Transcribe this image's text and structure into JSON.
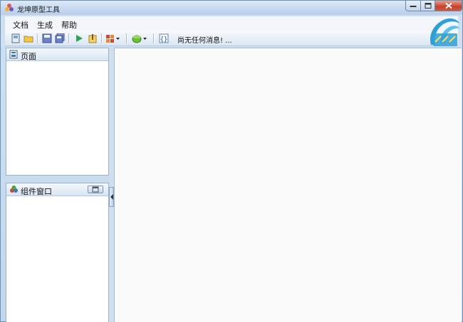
{
  "window": {
    "title": "龙坤原型工具"
  },
  "menu": {
    "items": [
      {
        "label": "文档"
      },
      {
        "label": "生成"
      },
      {
        "label": "帮助"
      }
    ]
  },
  "toolbar": {
    "status_message": "尚无任何消息!  ..."
  },
  "panels": {
    "pages": {
      "title": "页面"
    },
    "components": {
      "title": "组件窗口"
    }
  },
  "colors": {
    "accent": "#2f9fd8",
    "close_button": "#c6402a",
    "play_green": "#2ea44f"
  }
}
